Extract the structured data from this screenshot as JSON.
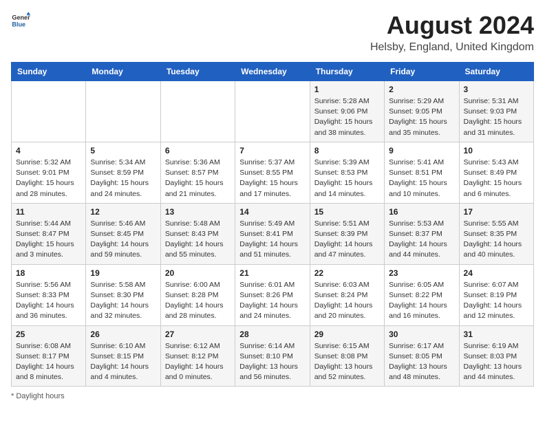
{
  "header": {
    "logo_general": "General",
    "logo_blue": "Blue",
    "title": "August 2024",
    "subtitle": "Helsby, England, United Kingdom"
  },
  "days_of_week": [
    "Sunday",
    "Monday",
    "Tuesday",
    "Wednesday",
    "Thursday",
    "Friday",
    "Saturday"
  ],
  "weeks": [
    [
      {
        "day": "",
        "info": ""
      },
      {
        "day": "",
        "info": ""
      },
      {
        "day": "",
        "info": ""
      },
      {
        "day": "",
        "info": ""
      },
      {
        "day": "1",
        "info": "Sunrise: 5:28 AM\nSunset: 9:06 PM\nDaylight: 15 hours\nand 38 minutes."
      },
      {
        "day": "2",
        "info": "Sunrise: 5:29 AM\nSunset: 9:05 PM\nDaylight: 15 hours\nand 35 minutes."
      },
      {
        "day": "3",
        "info": "Sunrise: 5:31 AM\nSunset: 9:03 PM\nDaylight: 15 hours\nand 31 minutes."
      }
    ],
    [
      {
        "day": "4",
        "info": "Sunrise: 5:32 AM\nSunset: 9:01 PM\nDaylight: 15 hours\nand 28 minutes."
      },
      {
        "day": "5",
        "info": "Sunrise: 5:34 AM\nSunset: 8:59 PM\nDaylight: 15 hours\nand 24 minutes."
      },
      {
        "day": "6",
        "info": "Sunrise: 5:36 AM\nSunset: 8:57 PM\nDaylight: 15 hours\nand 21 minutes."
      },
      {
        "day": "7",
        "info": "Sunrise: 5:37 AM\nSunset: 8:55 PM\nDaylight: 15 hours\nand 17 minutes."
      },
      {
        "day": "8",
        "info": "Sunrise: 5:39 AM\nSunset: 8:53 PM\nDaylight: 15 hours\nand 14 minutes."
      },
      {
        "day": "9",
        "info": "Sunrise: 5:41 AM\nSunset: 8:51 PM\nDaylight: 15 hours\nand 10 minutes."
      },
      {
        "day": "10",
        "info": "Sunrise: 5:43 AM\nSunset: 8:49 PM\nDaylight: 15 hours\nand 6 minutes."
      }
    ],
    [
      {
        "day": "11",
        "info": "Sunrise: 5:44 AM\nSunset: 8:47 PM\nDaylight: 15 hours\nand 3 minutes."
      },
      {
        "day": "12",
        "info": "Sunrise: 5:46 AM\nSunset: 8:45 PM\nDaylight: 14 hours\nand 59 minutes."
      },
      {
        "day": "13",
        "info": "Sunrise: 5:48 AM\nSunset: 8:43 PM\nDaylight: 14 hours\nand 55 minutes."
      },
      {
        "day": "14",
        "info": "Sunrise: 5:49 AM\nSunset: 8:41 PM\nDaylight: 14 hours\nand 51 minutes."
      },
      {
        "day": "15",
        "info": "Sunrise: 5:51 AM\nSunset: 8:39 PM\nDaylight: 14 hours\nand 47 minutes."
      },
      {
        "day": "16",
        "info": "Sunrise: 5:53 AM\nSunset: 8:37 PM\nDaylight: 14 hours\nand 44 minutes."
      },
      {
        "day": "17",
        "info": "Sunrise: 5:55 AM\nSunset: 8:35 PM\nDaylight: 14 hours\nand 40 minutes."
      }
    ],
    [
      {
        "day": "18",
        "info": "Sunrise: 5:56 AM\nSunset: 8:33 PM\nDaylight: 14 hours\nand 36 minutes."
      },
      {
        "day": "19",
        "info": "Sunrise: 5:58 AM\nSunset: 8:30 PM\nDaylight: 14 hours\nand 32 minutes."
      },
      {
        "day": "20",
        "info": "Sunrise: 6:00 AM\nSunset: 8:28 PM\nDaylight: 14 hours\nand 28 minutes."
      },
      {
        "day": "21",
        "info": "Sunrise: 6:01 AM\nSunset: 8:26 PM\nDaylight: 14 hours\nand 24 minutes."
      },
      {
        "day": "22",
        "info": "Sunrise: 6:03 AM\nSunset: 8:24 PM\nDaylight: 14 hours\nand 20 minutes."
      },
      {
        "day": "23",
        "info": "Sunrise: 6:05 AM\nSunset: 8:22 PM\nDaylight: 14 hours\nand 16 minutes."
      },
      {
        "day": "24",
        "info": "Sunrise: 6:07 AM\nSunset: 8:19 PM\nDaylight: 14 hours\nand 12 minutes."
      }
    ],
    [
      {
        "day": "25",
        "info": "Sunrise: 6:08 AM\nSunset: 8:17 PM\nDaylight: 14 hours\nand 8 minutes."
      },
      {
        "day": "26",
        "info": "Sunrise: 6:10 AM\nSunset: 8:15 PM\nDaylight: 14 hours\nand 4 minutes."
      },
      {
        "day": "27",
        "info": "Sunrise: 6:12 AM\nSunset: 8:12 PM\nDaylight: 14 hours\nand 0 minutes."
      },
      {
        "day": "28",
        "info": "Sunrise: 6:14 AM\nSunset: 8:10 PM\nDaylight: 13 hours\nand 56 minutes."
      },
      {
        "day": "29",
        "info": "Sunrise: 6:15 AM\nSunset: 8:08 PM\nDaylight: 13 hours\nand 52 minutes."
      },
      {
        "day": "30",
        "info": "Sunrise: 6:17 AM\nSunset: 8:05 PM\nDaylight: 13 hours\nand 48 minutes."
      },
      {
        "day": "31",
        "info": "Sunrise: 6:19 AM\nSunset: 8:03 PM\nDaylight: 13 hours\nand 44 minutes."
      }
    ]
  ],
  "footer": {
    "note": "Daylight hours"
  }
}
